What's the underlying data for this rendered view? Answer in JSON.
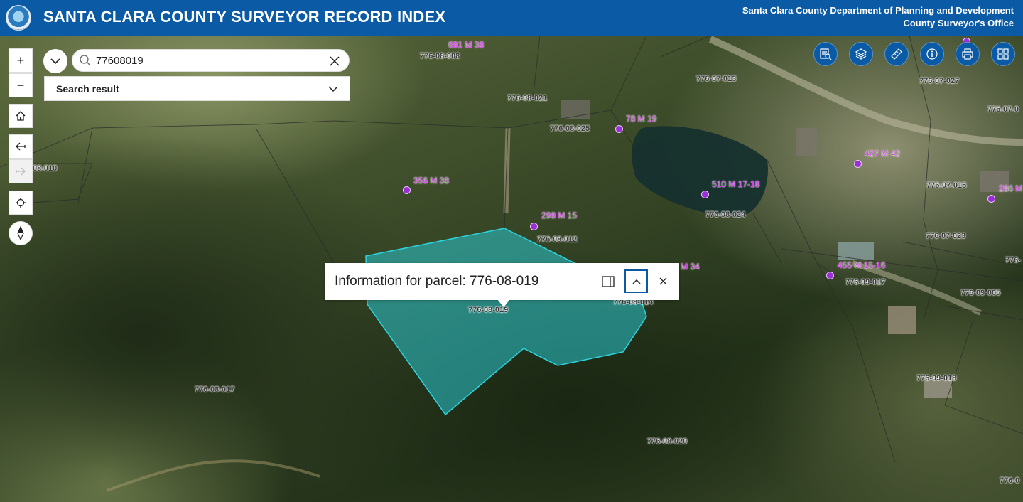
{
  "header": {
    "title": "SANTA CLARA COUNTY SURVEYOR RECORD INDEX",
    "department_line1": "Santa Clara County Department of Planning and Development",
    "department_line2": "County Surveyor's Office"
  },
  "search": {
    "value": "77608019",
    "result_label": "Search result"
  },
  "controls": {
    "zoom_in": "+",
    "zoom_out": "−"
  },
  "toolbar": [
    "search-records-icon",
    "layers-icon",
    "measure-icon",
    "info-icon",
    "print-icon",
    "basemap-gallery-icon"
  ],
  "popup": {
    "title": "Information for parcel: 776-08-019"
  },
  "parcel_labels": [
    "776-08-008",
    "776-08-021",
    "776-08-025",
    "776-07-013",
    "776-07-027",
    "776-07-0",
    "08-010",
    "776-07-015",
    "776-08-024",
    "776-08-012",
    "776-07-023",
    "776-08-019",
    "776-08-014",
    "776-09-017",
    "776-09-005",
    "776-08-017",
    "776-09-018",
    "776-08-020",
    "776-0",
    "776-"
  ],
  "record_labels": [
    "691 M 38",
    "78 M 19",
    "427 M 42",
    "356 M 38",
    "510 M 17-18",
    "286 M",
    "298 M 15",
    "M 34",
    "455 M 15-16"
  ],
  "colors": {
    "header": "#0b5aa6",
    "record": "#d43ee8",
    "selected_parcel": "#2ad4e0"
  }
}
